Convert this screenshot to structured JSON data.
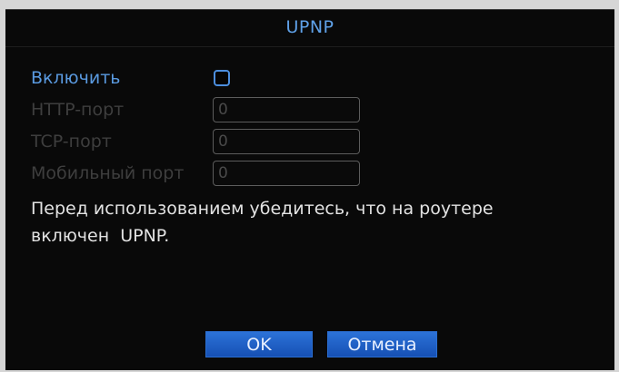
{
  "dialog": {
    "title": "UPNP"
  },
  "form": {
    "enable_label": "Включить",
    "enable_checked": false,
    "http_port_label": "HTTP-порт",
    "http_port_value": "0",
    "tcp_port_label": "TCP-порт",
    "tcp_port_value": "0",
    "mobile_port_label": "Мобильный порт",
    "mobile_port_value": "0"
  },
  "hint": {
    "line1": "Перед использованием убедитесь, что на роутере",
    "line2": "включен  UPNP."
  },
  "buttons": {
    "ok_label": "OK",
    "cancel_label": "Отмена"
  },
  "colors": {
    "accent": "#5a9ae0",
    "button": "#1e5fc6",
    "background": "#090909",
    "disabled_text": "#3e3e3e"
  }
}
